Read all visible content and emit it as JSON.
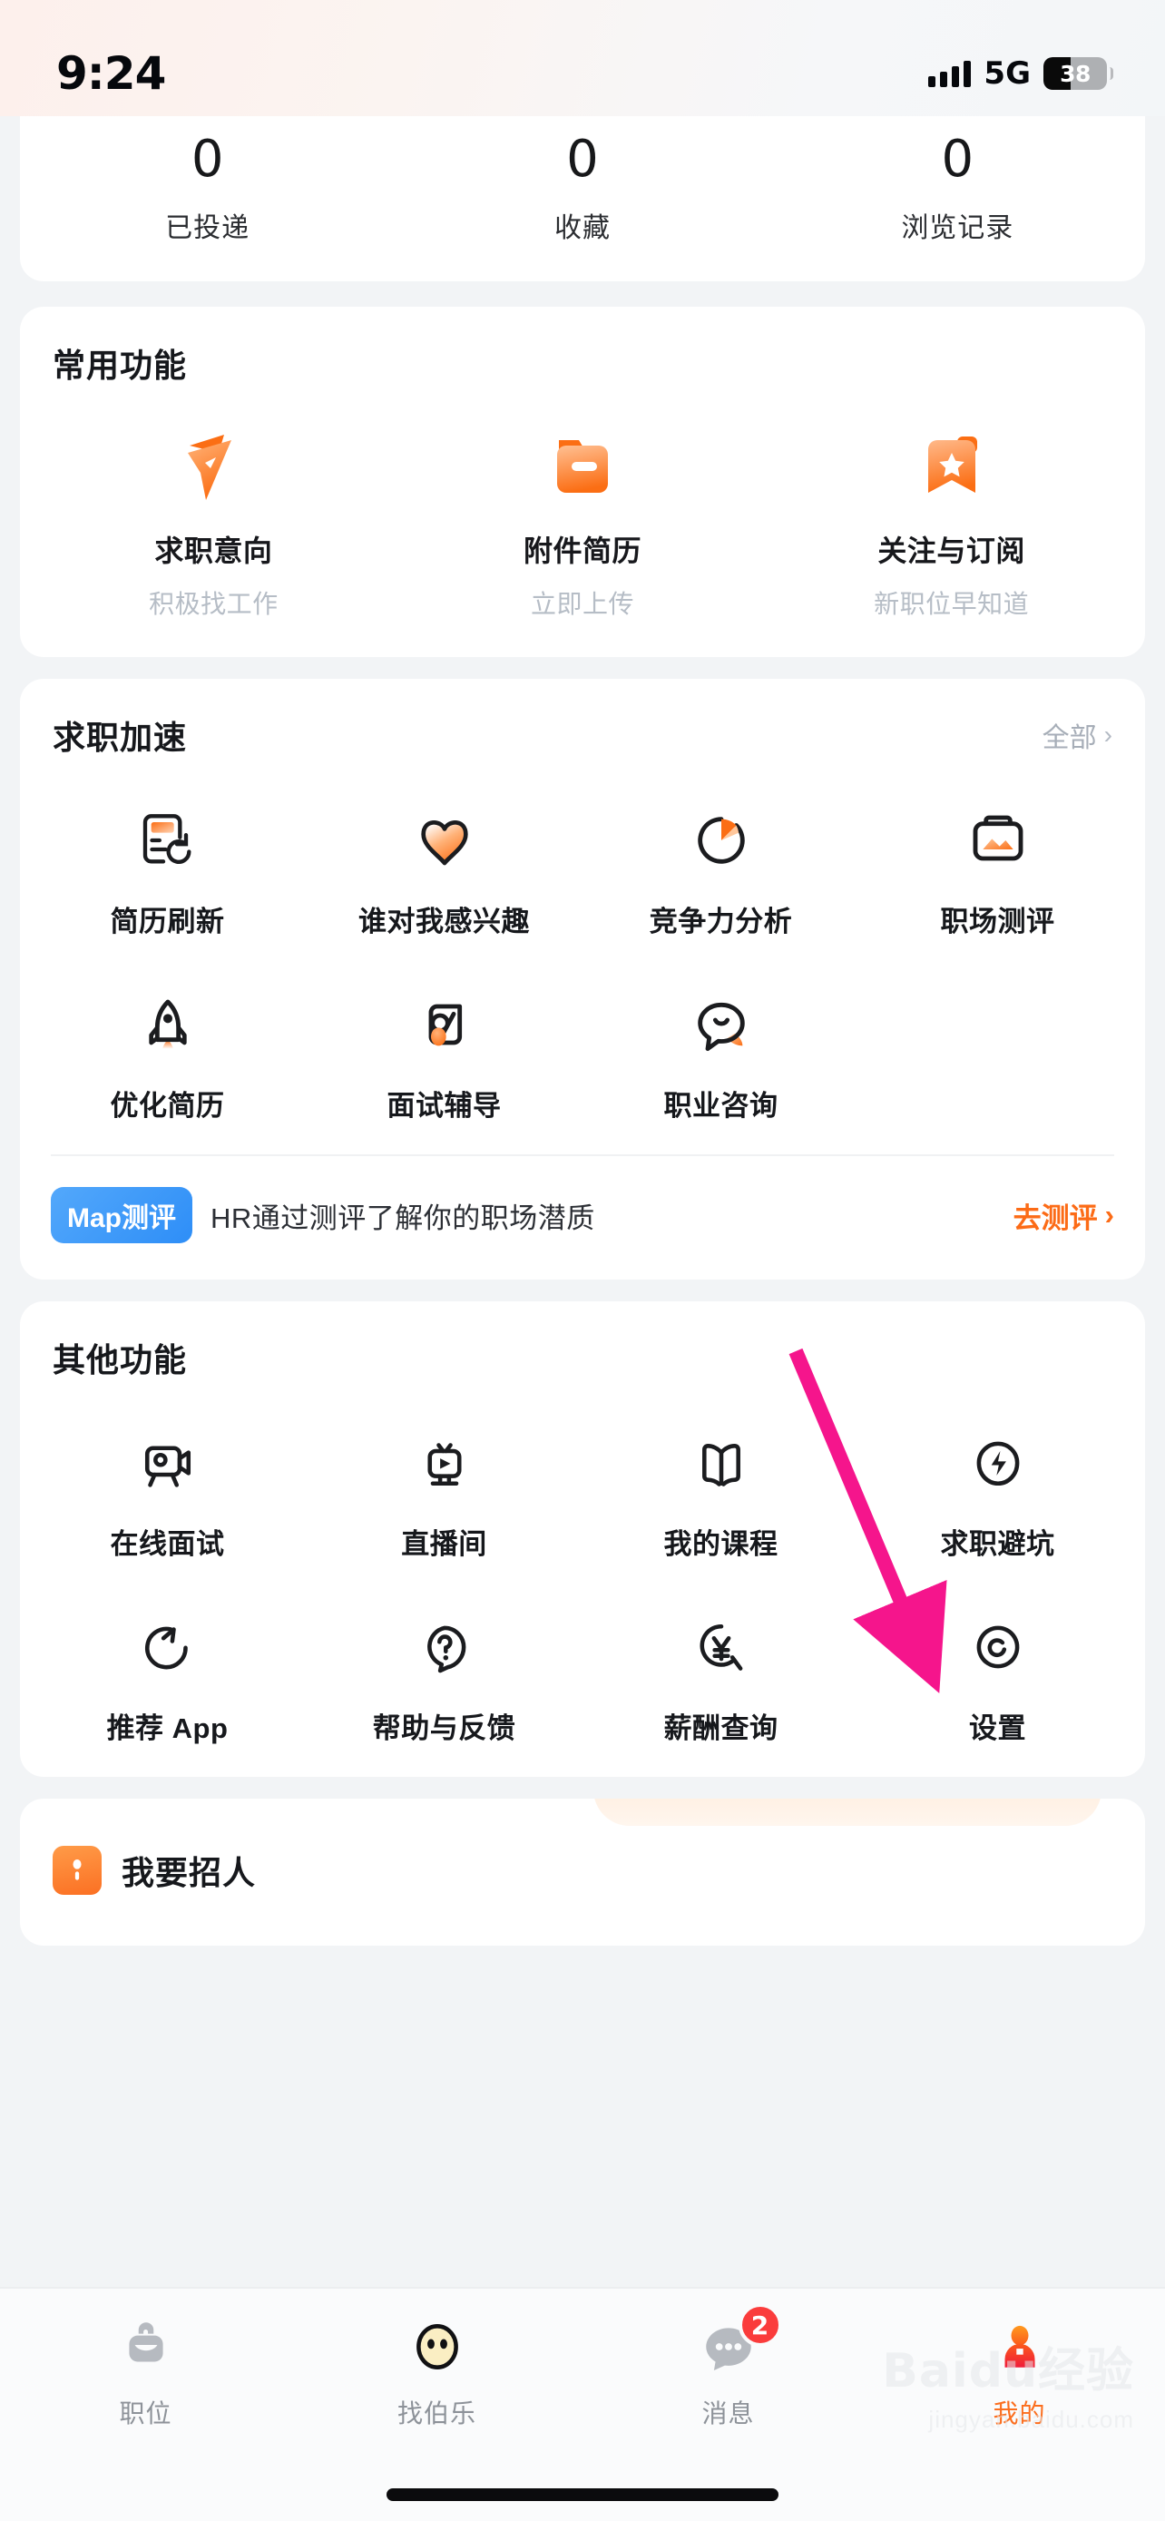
{
  "status_bar": {
    "time": "9:24",
    "network": "5G",
    "battery_percent": "38",
    "signal_icon": "signal-bars-icon",
    "battery_icon": "battery-icon"
  },
  "stats": [
    {
      "value": "0",
      "label": "已投递"
    },
    {
      "value": "0",
      "label": "收藏"
    },
    {
      "value": "0",
      "label": "浏览记录"
    }
  ],
  "common_functions": {
    "title": "常用功能",
    "items": [
      {
        "label": "求职意向",
        "subtitle": "积极找工作",
        "icon": "paper-plane-icon"
      },
      {
        "label": "附件简历",
        "subtitle": "立即上传",
        "icon": "folder-icon"
      },
      {
        "label": "关注与订阅",
        "subtitle": "新职位早知道",
        "icon": "bookmark-star-icon"
      }
    ]
  },
  "job_boost": {
    "title": "求职加速",
    "more_label": "全部",
    "more_chevron": "›",
    "items": [
      {
        "label": "简历刷新",
        "icon": "resume-refresh-icon"
      },
      {
        "label": "谁对我感兴趣",
        "icon": "heart-icon"
      },
      {
        "label": "竞争力分析",
        "icon": "pie-chart-icon"
      },
      {
        "label": "职场测评",
        "icon": "clipboard-icon"
      },
      {
        "label": "优化简历",
        "icon": "rocket-icon"
      },
      {
        "label": "面试辅导",
        "icon": "mobile-chat-icon"
      },
      {
        "label": "职业咨询",
        "icon": "speech-bubble-icon"
      }
    ],
    "banner": {
      "badge": "Map测评",
      "text": "HR通过测评了解你的职场潜质",
      "cta": "去测评",
      "cta_chevron": "›",
      "badge_color": "#2e8ef7",
      "cta_color": "#fc6b16"
    }
  },
  "other_functions": {
    "title": "其他功能",
    "items": [
      {
        "label": "在线面试",
        "icon": "video-camera-icon"
      },
      {
        "label": "直播间",
        "icon": "live-stream-icon"
      },
      {
        "label": "我的课程",
        "icon": "open-book-icon"
      },
      {
        "label": "求职避坑",
        "icon": "shield-bolt-icon"
      },
      {
        "label": "推荐 App",
        "icon": "share-arrow-icon"
      },
      {
        "label": "帮助与反馈",
        "icon": "question-mark-icon"
      },
      {
        "label": "薪酬查询",
        "icon": "yen-search-icon"
      },
      {
        "label": "设置",
        "icon": "gear-circle-icon"
      }
    ]
  },
  "recruiter_bar": {
    "label": "我要招人",
    "icon": "recruiter-person-icon"
  },
  "tab_bar": {
    "items": [
      {
        "label": "职位",
        "icon": "briefcase-icon",
        "active": false,
        "badge": ""
      },
      {
        "label": "找伯乐",
        "icon": "smiley-face-icon",
        "active": false,
        "badge": ""
      },
      {
        "label": "消息",
        "icon": "chat-bubble-icon",
        "active": false,
        "badge": "2"
      },
      {
        "label": "我的",
        "icon": "person-icon",
        "active": true,
        "badge": ""
      }
    ],
    "active_color": "#fb6e1e",
    "badge_color": "#fa3c3c"
  },
  "watermark": {
    "brand": "Baidu经验",
    "url": "jingyan.baidu.com"
  },
  "annotation": {
    "arrow_color": "#f5158c"
  }
}
